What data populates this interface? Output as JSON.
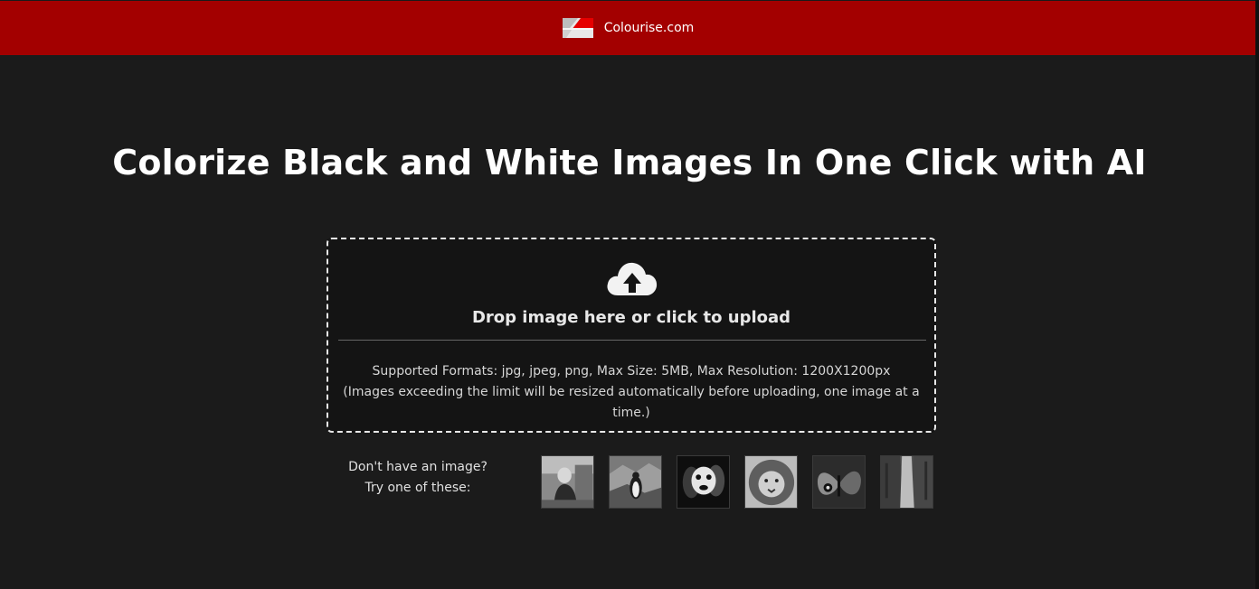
{
  "header": {
    "brand": "Colourise.com",
    "logo_icon": "flag-logo-icon",
    "background_color": "#a30000"
  },
  "main": {
    "headline": "Colorize Black and White Images In One Click with AI"
  },
  "upload": {
    "icon": "cloud-upload-icon",
    "drop_text": "Drop image here or click to upload",
    "formats_line": "Supported Formats: jpg, jpeg, png, Max Size: 5MB, Max Resolution: 1200X1200px",
    "limits_line": "(Images exceeding the limit will be resized automatically before uploading, one image at a time.)"
  },
  "samples": {
    "prompt_line1": "Don't have an image?",
    "prompt_line2": "Try one of these:",
    "items": [
      {
        "name": "sample-woman-thumbnail"
      },
      {
        "name": "sample-penguin-thumbnail"
      },
      {
        "name": "sample-dog-thumbnail"
      },
      {
        "name": "sample-lion-thumbnail"
      },
      {
        "name": "sample-butterfly-thumbnail"
      },
      {
        "name": "sample-street-thumbnail"
      }
    ]
  }
}
